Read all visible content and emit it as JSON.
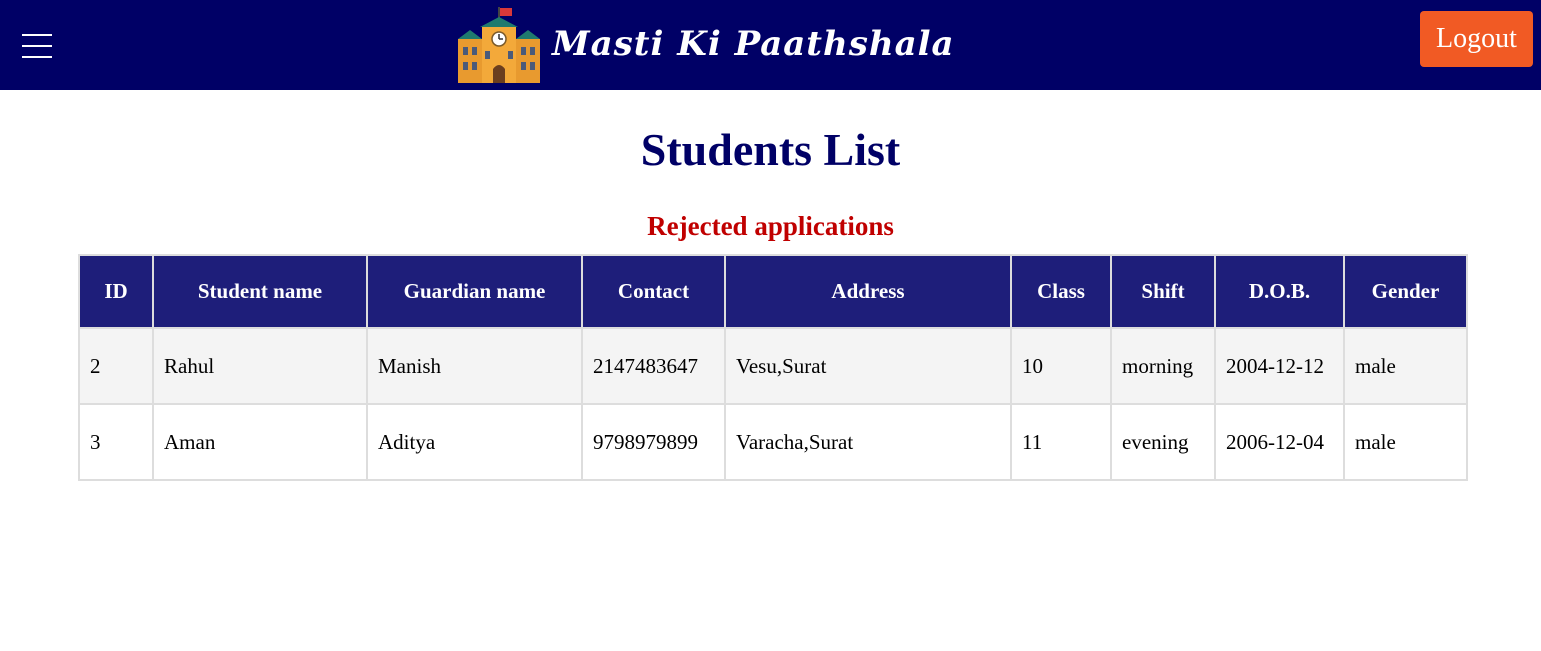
{
  "header": {
    "brand_name": "Masti Ki Paathshala",
    "brand_icon": "school-building-icon",
    "menu_icon": "hamburger-menu-icon",
    "logout_label": "Logout"
  },
  "page": {
    "title": "Students List",
    "section_title": "Rejected applications"
  },
  "table": {
    "columns": [
      "ID",
      "Student name",
      "Guardian name",
      "Contact",
      "Address",
      "Class",
      "Shift",
      "D.O.B.",
      "Gender"
    ],
    "rows": [
      [
        "2",
        "Rahul",
        "Manish",
        "2147483647",
        "Vesu,Surat",
        "10",
        "morning",
        "2004-12-12",
        "male"
      ],
      [
        "3",
        "Aman",
        "Aditya",
        "9798979899",
        "Varacha,Surat",
        "11",
        "evening",
        "2006-12-04",
        "male"
      ]
    ]
  },
  "colors": {
    "navbar": "#000066",
    "logout_button": "#f15a24",
    "title": "#000066",
    "section_title": "#c00000",
    "table_header": "#1e1e7a"
  }
}
